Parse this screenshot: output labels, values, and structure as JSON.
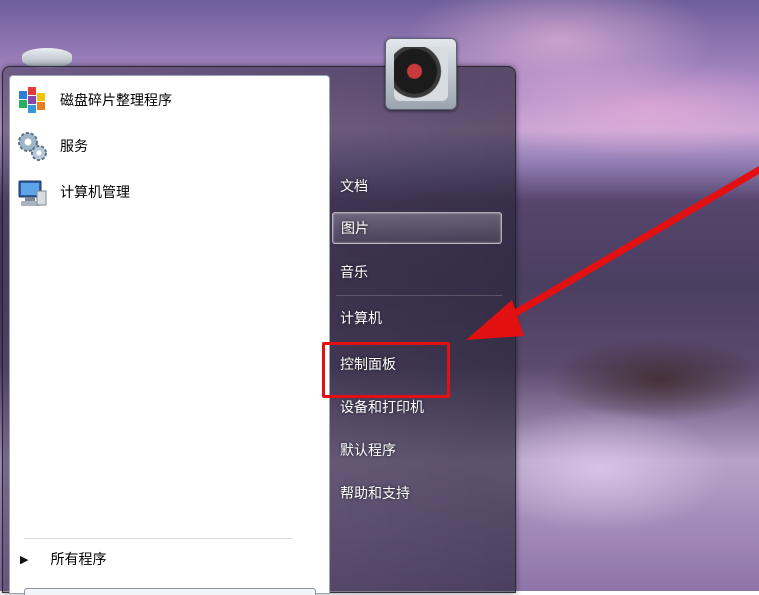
{
  "desktop": {
    "wallpaper": "purple-sunset-seascape"
  },
  "start_menu": {
    "pinned_programs": [
      {
        "label": "磁盘碎片整理程序",
        "icon": "defrag-icon"
      },
      {
        "label": "服务",
        "icon": "gears-icon"
      },
      {
        "label": "计算机管理",
        "icon": "computer-management-icon"
      }
    ],
    "all_programs_label": "所有程序",
    "right_items": [
      {
        "label": "文档"
      },
      {
        "label": "图片"
      },
      {
        "label": "音乐"
      },
      {
        "label": "计算机"
      },
      {
        "label": "控制面板"
      },
      {
        "label": "设备和打印机"
      },
      {
        "label": "默认程序"
      },
      {
        "label": "帮助和支持"
      }
    ],
    "hovered_item": "图片",
    "highlighted_item": "控制面板"
  },
  "annotation": {
    "highlight_color": "#e21010",
    "arrow_color": "#e21010"
  }
}
